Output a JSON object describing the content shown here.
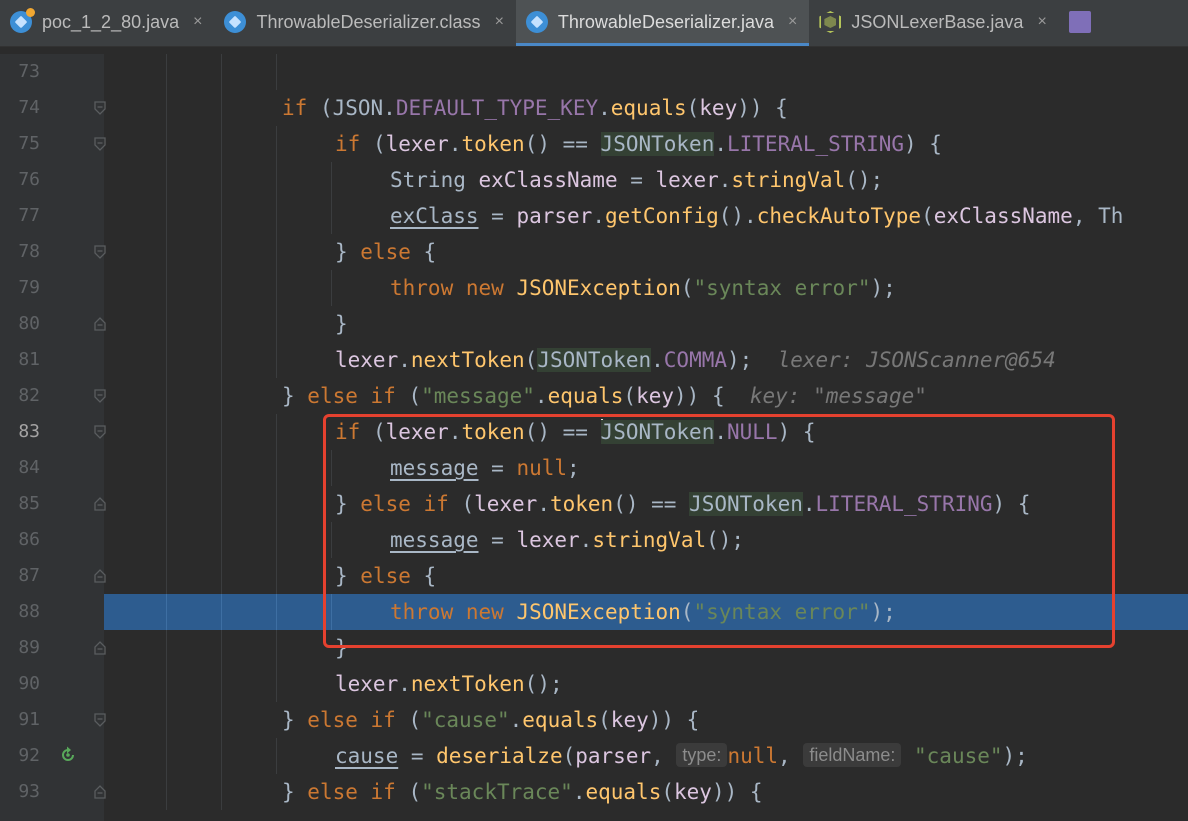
{
  "tabs": [
    {
      "label": "poc_1_2_80.java",
      "icon": "java-icon",
      "active": false
    },
    {
      "label": "ThrowableDeserializer.class",
      "icon": "class-icon",
      "active": false
    },
    {
      "label": "ThrowableDeserializer.java",
      "icon": "java-icon",
      "active": true
    },
    {
      "label": "JSONLexerBase.java",
      "icon": "class-icon",
      "active": false
    },
    {
      "label": "",
      "icon": "binary-file-icon",
      "active": false
    }
  ],
  "close_glyph": "×",
  "lines": [
    {
      "n": "73"
    },
    {
      "n": "74"
    },
    {
      "n": "75"
    },
    {
      "n": "76"
    },
    {
      "n": "77"
    },
    {
      "n": "78"
    },
    {
      "n": "79"
    },
    {
      "n": "80"
    },
    {
      "n": "81",
      "hint": "lexer: JSONScanner@654"
    },
    {
      "n": "82",
      "hint": "key: \"message\""
    },
    {
      "n": "83"
    },
    {
      "n": "84"
    },
    {
      "n": "85"
    },
    {
      "n": "86"
    },
    {
      "n": "87"
    },
    {
      "n": "88"
    },
    {
      "n": "89"
    },
    {
      "n": "90"
    },
    {
      "n": "91"
    },
    {
      "n": "92",
      "hints": [
        "type:",
        "fieldName:"
      ]
    },
    {
      "n": "93"
    }
  ],
  "colors": {
    "keyword": "#cc7832",
    "string": "#6a8759",
    "field": "#9876aa",
    "method": "#ffc66d",
    "exec_line": "#2d5c8f",
    "annotation_box": "#e5412f"
  }
}
